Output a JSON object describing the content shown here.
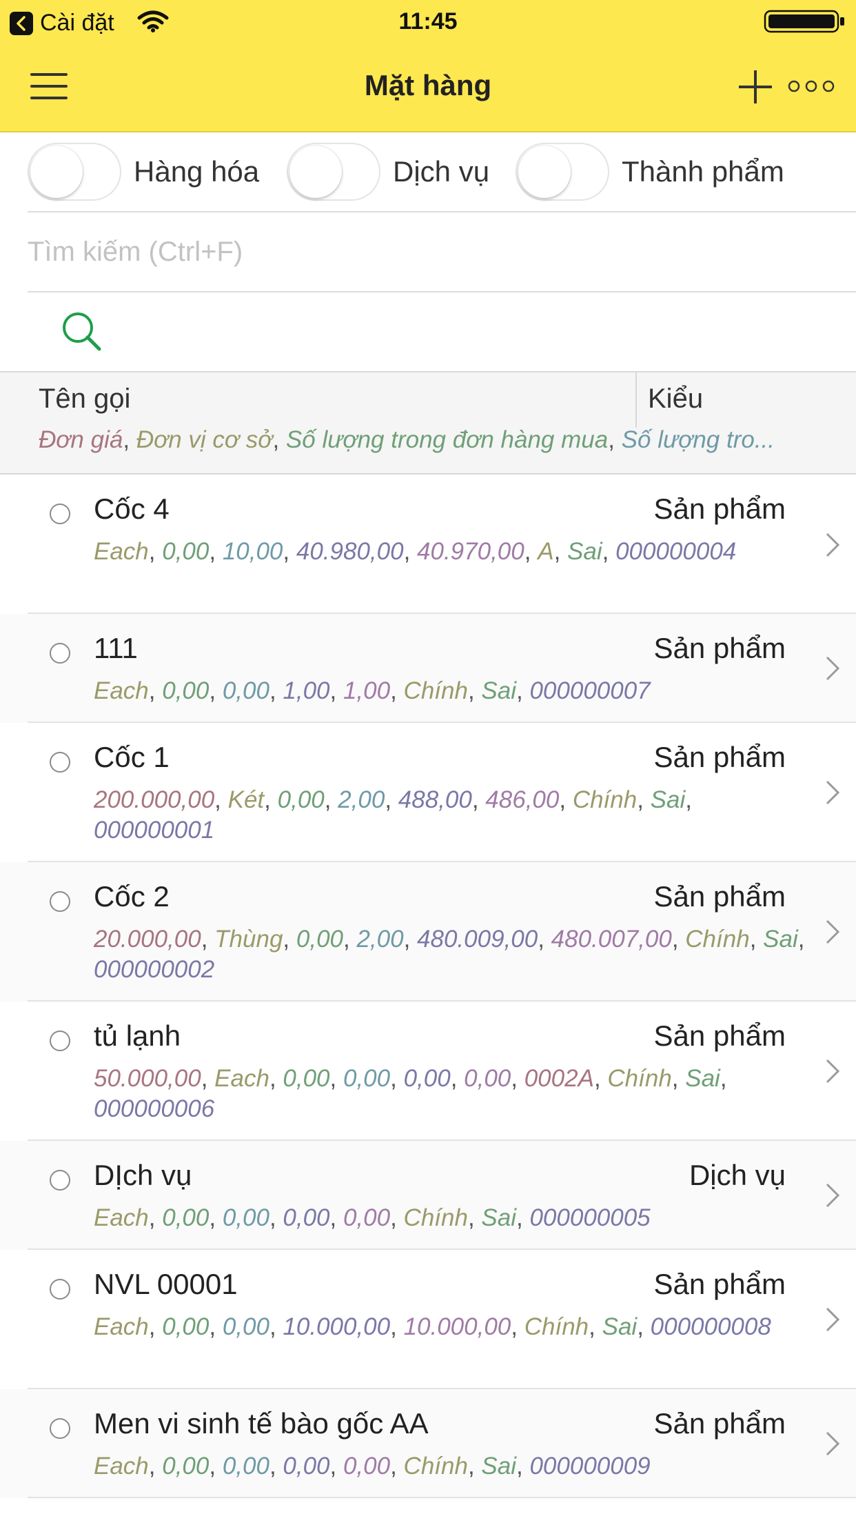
{
  "status_bar": {
    "back_app_label": "Cài đặt",
    "time": "11:45"
  },
  "nav": {
    "title": "Mặt hàng"
  },
  "filters": [
    {
      "label": "Hàng hóa",
      "on": false
    },
    {
      "label": "Dịch vụ",
      "on": false
    },
    {
      "label": "Thành phẩm",
      "on": false
    }
  ],
  "search": {
    "placeholder": "Tìm kiếm (Ctrl+F)",
    "value": ""
  },
  "list_header": {
    "name_col": "Tên gọi",
    "type_col": "Kiểu",
    "fields": [
      "Đơn giá",
      "Đơn vị cơ sở",
      "Số lượng trong đơn hàng mua",
      "Số lượng tro..."
    ]
  },
  "colors": {
    "nav_background": "#fde84f",
    "field_palette": [
      "#a7757f",
      "#9a9a6a",
      "#6f9f77",
      "#6e9aa6",
      "#7a78a6",
      "#a07aa6"
    ]
  },
  "items": [
    {
      "name": "Cốc 4",
      "type": "Sản phẩm",
      "fields": [
        {
          "text": "Each",
          "c": 1
        },
        {
          "text": "0,00",
          "c": 2
        },
        {
          "text": "10,00",
          "c": 3
        },
        {
          "text": "40.980,00",
          "c": 4
        },
        {
          "text": "40.970,00",
          "c": 5
        },
        {
          "text": "A",
          "c": 1
        },
        {
          "text": "Sai",
          "c": 2
        },
        {
          "text": "000000004",
          "c": 4
        }
      ]
    },
    {
      "name": "111",
      "type": "Sản phẩm",
      "fields": [
        {
          "text": "Each",
          "c": 1
        },
        {
          "text": "0,00",
          "c": 2
        },
        {
          "text": "0,00",
          "c": 3
        },
        {
          "text": "1,00",
          "c": 4
        },
        {
          "text": "1,00",
          "c": 5
        },
        {
          "text": "Chính",
          "c": 1
        },
        {
          "text": "Sai",
          "c": 2
        },
        {
          "text": "000000007",
          "c": 4
        }
      ]
    },
    {
      "name": "Cốc 1",
      "type": "Sản phẩm",
      "fields": [
        {
          "text": "200.000,00",
          "c": 0
        },
        {
          "text": "Két",
          "c": 1
        },
        {
          "text": "0,00",
          "c": 2
        },
        {
          "text": "2,00",
          "c": 3
        },
        {
          "text": "488,00",
          "c": 4
        },
        {
          "text": "486,00",
          "c": 5
        },
        {
          "text": "Chính",
          "c": 1
        },
        {
          "text": "Sai",
          "c": 2
        },
        {
          "text": "000000001",
          "c": 4
        }
      ]
    },
    {
      "name": "Cốc 2",
      "type": "Sản phẩm",
      "fields": [
        {
          "text": "20.000,00",
          "c": 0
        },
        {
          "text": "Thùng",
          "c": 1
        },
        {
          "text": "0,00",
          "c": 2
        },
        {
          "text": "2,00",
          "c": 3
        },
        {
          "text": "480.009,00",
          "c": 4
        },
        {
          "text": "480.007,00",
          "c": 5
        },
        {
          "text": "Chính",
          "c": 1
        },
        {
          "text": "Sai",
          "c": 2
        },
        {
          "text": "000000002",
          "c": 4
        }
      ]
    },
    {
      "name": "tủ lạnh",
      "type": "Sản phẩm",
      "fields": [
        {
          "text": "50.000,00",
          "c": 0
        },
        {
          "text": "Each",
          "c": 1
        },
        {
          "text": "0,00",
          "c": 2
        },
        {
          "text": "0,00",
          "c": 3
        },
        {
          "text": "0,00",
          "c": 4
        },
        {
          "text": "0,00",
          "c": 5
        },
        {
          "text": "0002A",
          "c": 0
        },
        {
          "text": "Chính",
          "c": 1
        },
        {
          "text": "Sai",
          "c": 2
        },
        {
          "text": "000000006",
          "c": 4
        }
      ]
    },
    {
      "name": "DỊch vụ",
      "type": "Dịch vụ",
      "fields": [
        {
          "text": "Each",
          "c": 1
        },
        {
          "text": "0,00",
          "c": 2
        },
        {
          "text": "0,00",
          "c": 3
        },
        {
          "text": "0,00",
          "c": 4
        },
        {
          "text": "0,00",
          "c": 5
        },
        {
          "text": "Chính",
          "c": 1
        },
        {
          "text": "Sai",
          "c": 2
        },
        {
          "text": "000000005",
          "c": 4
        }
      ]
    },
    {
      "name": "NVL 00001",
      "type": "Sản phẩm",
      "fields": [
        {
          "text": "Each",
          "c": 1
        },
        {
          "text": "0,00",
          "c": 2
        },
        {
          "text": "0,00",
          "c": 3
        },
        {
          "text": "10.000,00",
          "c": 4
        },
        {
          "text": "10.000,00",
          "c": 5
        },
        {
          "text": "Chính",
          "c": 1
        },
        {
          "text": "Sai",
          "c": 2
        },
        {
          "text": "000000008",
          "c": 4
        }
      ]
    },
    {
      "name": "Men vi sinh tế bào gốc AA",
      "type": "Sản phẩm",
      "fields": [
        {
          "text": "Each",
          "c": 1
        },
        {
          "text": "0,00",
          "c": 2
        },
        {
          "text": "0,00",
          "c": 3
        },
        {
          "text": "0,00",
          "c": 4
        },
        {
          "text": "0,00",
          "c": 5
        },
        {
          "text": "Chính",
          "c": 1
        },
        {
          "text": "Sai",
          "c": 2
        },
        {
          "text": "000000009",
          "c": 4
        }
      ]
    }
  ]
}
